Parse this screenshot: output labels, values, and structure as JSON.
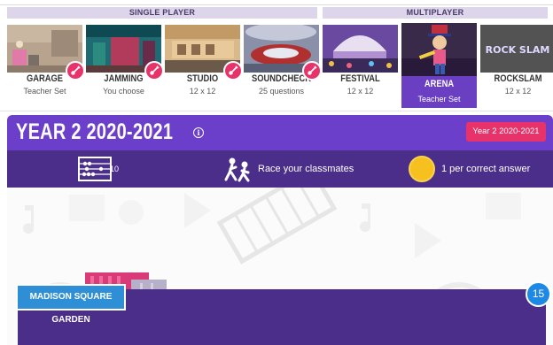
{
  "modes": {
    "single_player_label": "SINGLE PLAYER",
    "multiplayer_label": "MULTIPLAYER",
    "tiles": [
      {
        "name": "GARAGE",
        "sub": "Teacher Set"
      },
      {
        "name": "JAMMING",
        "sub": "You choose"
      },
      {
        "name": "STUDIO",
        "sub": "12 x 12"
      },
      {
        "name": "SOUNDCHECK",
        "sub": "25 questions"
      },
      {
        "name": "FESTIVAL",
        "sub": "12 x 12"
      },
      {
        "name": "ARENA",
        "sub": "Teacher Set"
      },
      {
        "name": "ROCKSLAM",
        "sub": "12 x 12"
      }
    ],
    "rockslam_logo_text": "ROCK SLAM"
  },
  "header": {
    "title": "YEAR 2 2020-2021",
    "info_icon": "info-icon",
    "class_button": "Year 2 2020-2021"
  },
  "stats": {
    "count": "10",
    "race": "Race your classmates",
    "coins": "1 per correct answer"
  },
  "venue": {
    "name": "MADISON SQUARE GARDEN",
    "player_count": "15"
  },
  "colors": {
    "purple": "#6b3fc9",
    "dark_purple": "#4b2e8a",
    "pink": "#e8336a",
    "blue": "#2f8fd6",
    "gold": "#f6c01f"
  }
}
